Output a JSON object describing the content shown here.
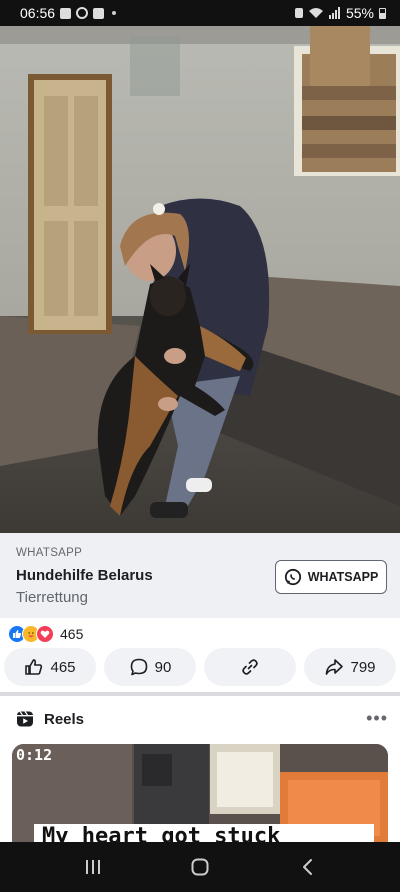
{
  "status_bar": {
    "time": "06:56",
    "battery": "55%"
  },
  "ad": {
    "source": "WHATSAPP",
    "title": "Hundehilfe Belarus",
    "subtitle": "Tierrettung",
    "cta_label": "WHATSAPP"
  },
  "reactions": {
    "count": "465"
  },
  "actions": {
    "like_count": "465",
    "comment_count": "90",
    "share_count": "799"
  },
  "reels": {
    "title": "Reels",
    "more": "•••",
    "thumb_time": "0:12",
    "thumb_caption": "My heart got stuck"
  },
  "colors": {
    "facebook_blue": "#1877f2",
    "love_red": "#f33e58",
    "care_yellow": "#f7b928",
    "whatsapp_green": "#25d366"
  }
}
